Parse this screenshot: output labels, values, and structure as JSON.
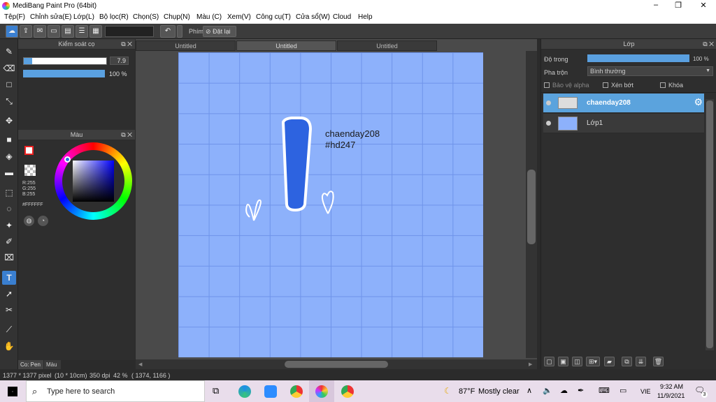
{
  "window": {
    "title": "MediBang Paint Pro (64bit)",
    "min": "–",
    "max": "❐",
    "close": "✕"
  },
  "menu": [
    "Tệp(F)",
    "Chỉnh sửa(E)",
    "Lớp(L)",
    "Bộ lọc(R)",
    "Chọn(S)",
    "Chụp(N)",
    "Màu (C)",
    "Xem(V)",
    "Công cụ(T)",
    "Cửa sổ(W)",
    "Cloud",
    "Help"
  ],
  "toolbar": {
    "key_label": "Phím",
    "reset_label": "Đặt lại"
  },
  "brush_panel": {
    "title": "Kiểm soát cọ",
    "size_value": "7.9",
    "opacity_value": "100 %",
    "size_fraction": 0.1,
    "opacity_fraction": 1.0
  },
  "color_panel": {
    "title": "Màu",
    "r": "R:255",
    "g": "G:255",
    "b": "B:255",
    "hex": "#FFFFFF",
    "fg_color": "#ffffff",
    "bg_color": "#ffffff"
  },
  "doc_tabs": [
    "Untitled",
    "Untitled",
    "Untitled"
  ],
  "canvas": {
    "text_line1": "chaenday208",
    "text_line2": "#hd247",
    "background": "#8db1fb",
    "accent": "#2d63e0"
  },
  "layer_panel": {
    "title": "Lớp",
    "opacity_label": "Độ trong",
    "opacity_value": "100 %",
    "opacity_fraction": 1.0,
    "blend_label": "Pha trộn",
    "blend_value": "Bình thường",
    "protect_alpha": "Bảo vệ alpha",
    "clipping": "Xén bớt",
    "lock": "Khóa",
    "layers": [
      {
        "name": "chaenday208",
        "selected": true
      },
      {
        "name": "Lớp1",
        "selected": false
      }
    ]
  },
  "left_tabs": {
    "pen_tab": "Co: Pen",
    "color_tab": "Màu"
  },
  "status": {
    "size": "1377 * 1377 pixel",
    "dims": "(10 * 10cm)",
    "dpi": "350 dpi",
    "zoom": "42 %",
    "coords": "( 1374, 1166 )"
  },
  "taskbar": {
    "search_placeholder": "Type here to search",
    "temp": "87°F",
    "weather": "Mostly clear",
    "lang": "VIE",
    "time": "9:32 AM",
    "date": "11/9/2021",
    "notif_count": "3"
  }
}
